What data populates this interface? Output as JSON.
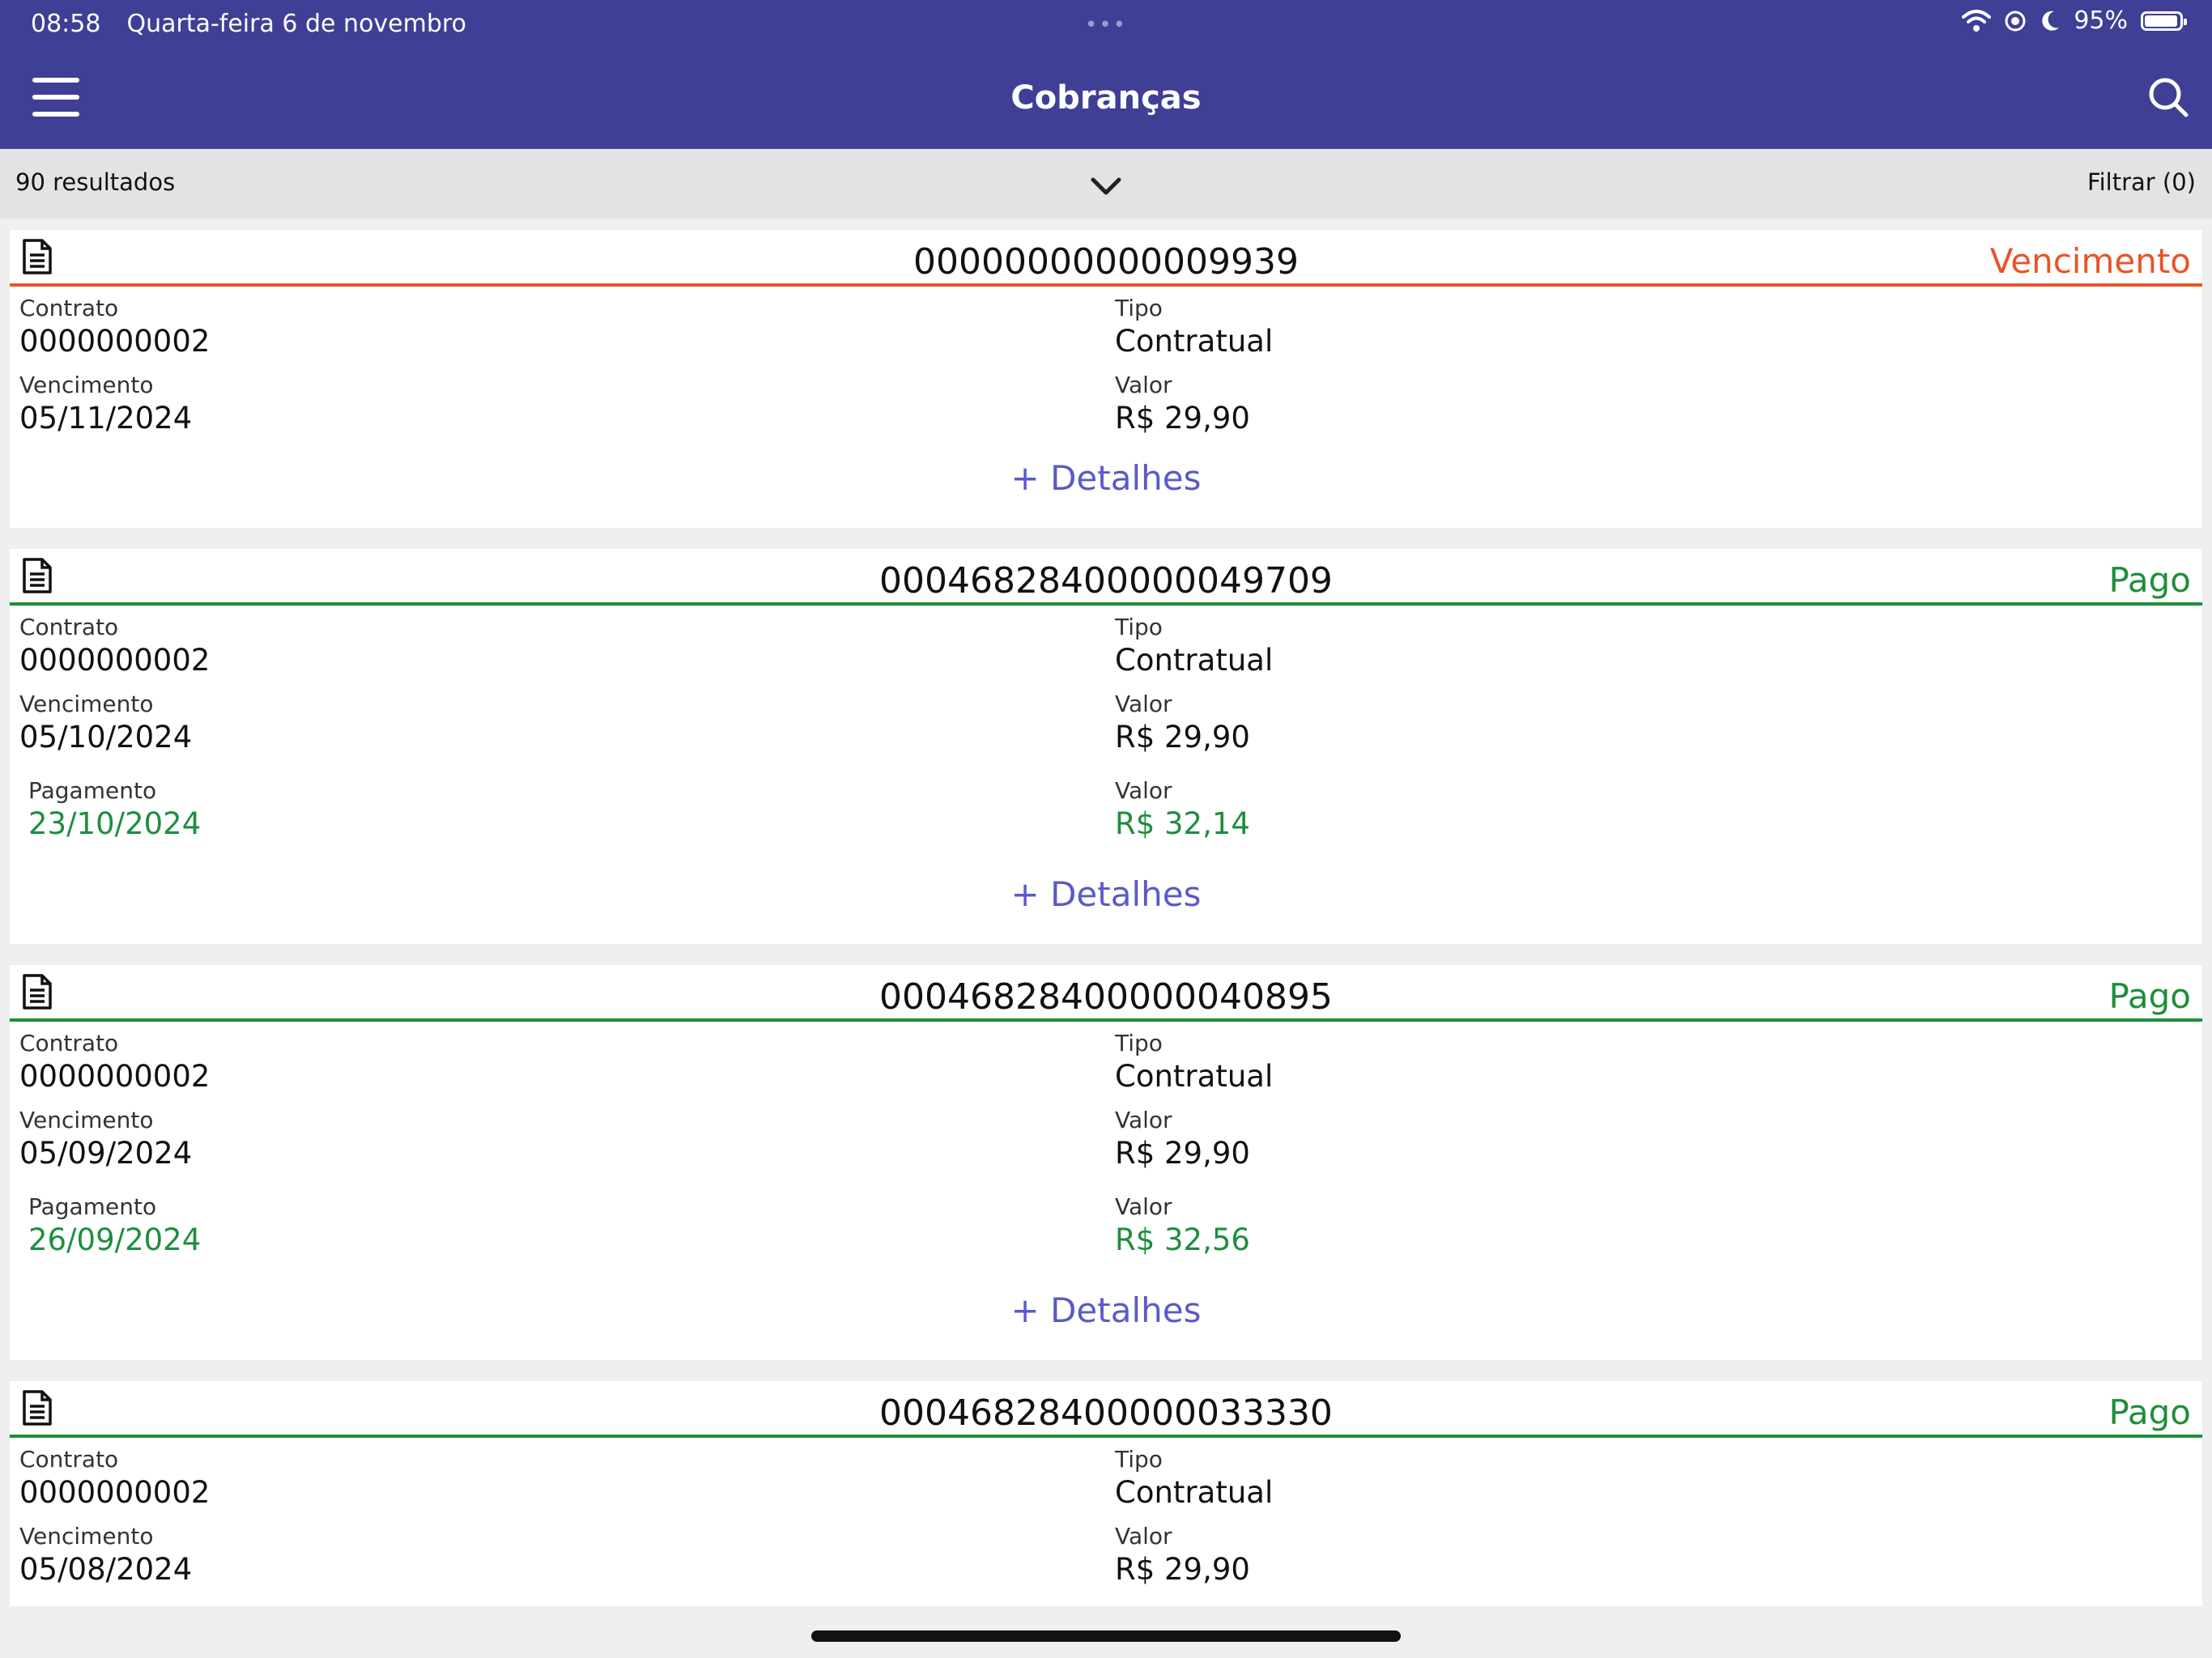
{
  "status_bar": {
    "time": "08:58",
    "date": "Quarta-feira 6 de novembro",
    "battery": "95%",
    "battery_level": 0.95,
    "icons": [
      "wifi-icon",
      "location-icon",
      "moon-icon",
      "battery-icon"
    ]
  },
  "header": {
    "title": "Cobranças",
    "menu_icon": "hamburger-menu-icon",
    "search_icon": "search-icon",
    "color": "#3f3f96"
  },
  "results_bar": {
    "count": "90 resultados",
    "filter": "Filtrar (0)"
  },
  "cards": [
    {
      "code": "00000000000009939",
      "status": "Vencimento",
      "status_color": "#e8542a",
      "contrato_label": "Contrato",
      "contrato": "0000000002",
      "tipo_label": "Tipo",
      "tipo": "Contratual",
      "vencimento_label": "Vencimento",
      "vencimento": "05/11/2024",
      "valor_label": "Valor",
      "valor": "R$ 29,90",
      "details": "+ Detalhes"
    },
    {
      "code": "00046828400000049709",
      "status": "Pago",
      "status_color": "#1e8e3e",
      "contrato_label": "Contrato",
      "contrato": "0000000002",
      "tipo_label": "Tipo",
      "tipo": "Contratual",
      "vencimento_label": "Vencimento",
      "vencimento": "05/10/2024",
      "valor_label": "Valor",
      "valor": "R$ 29,90",
      "pagamento_label": "Pagamento",
      "pagamento": "23/10/2024",
      "valor_pago_label": "Valor",
      "valor_pago": "R$ 32,14",
      "details": "+ Detalhes"
    },
    {
      "code": "00046828400000040895",
      "status": "Pago",
      "status_color": "#1e8e3e",
      "contrato_label": "Contrato",
      "contrato": "0000000002",
      "tipo_label": "Tipo",
      "tipo": "Contratual",
      "vencimento_label": "Vencimento",
      "vencimento": "05/09/2024",
      "valor_label": "Valor",
      "valor": "R$ 29,90",
      "pagamento_label": "Pagamento",
      "pagamento": "26/09/2024",
      "valor_pago_label": "Valor",
      "valor_pago": "R$ 32,56",
      "details": "+ Detalhes"
    },
    {
      "code": "00046828400000033330",
      "status": "Pago",
      "status_color": "#1e8e3e",
      "contrato_label": "Contrato",
      "contrato": "0000000002",
      "tipo_label": "Tipo",
      "tipo": "Contratual",
      "vencimento_label": "Vencimento",
      "vencimento": "05/08/2024",
      "valor_label": "Valor",
      "valor": "R$ 29,90"
    }
  ]
}
